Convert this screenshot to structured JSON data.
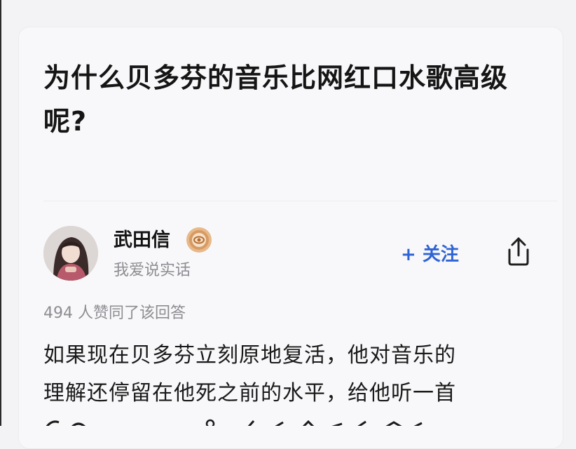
{
  "question": {
    "title_line1": "为什么贝多芬的音乐比网红口水歌高级",
    "title_line2": "呢?"
  },
  "author": {
    "name": "武田信",
    "bio": "我爱说实话",
    "badge_icon": "honor-badge-icon",
    "avatar_icon": "avatar"
  },
  "actions": {
    "follow_label": "+ 关注",
    "share_icon": "share-icon"
  },
  "answer": {
    "vote_text": "494 人赞同了该回答",
    "line1": "如果现在贝多芬立刻原地复活，他对音乐的",
    "line2": "理解还停留在他死之前的水平，给他听一首"
  },
  "colors": {
    "accent": "#2f64d6",
    "text_primary": "#151515",
    "text_secondary": "#8d8d92",
    "card_bg": "#f8f8fa"
  }
}
